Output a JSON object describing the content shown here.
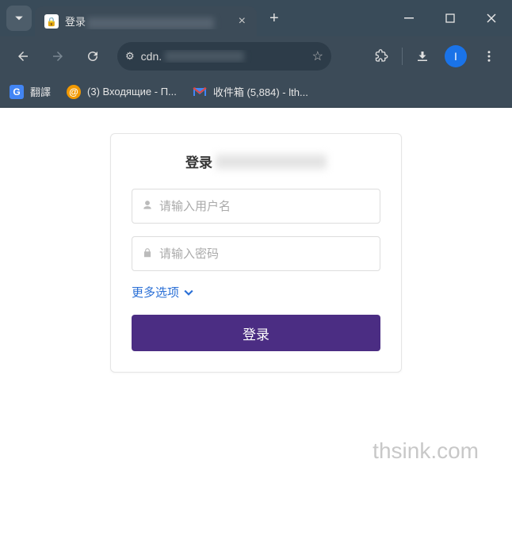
{
  "browser": {
    "tab_title_prefix": "登录",
    "tab_close": "×",
    "new_tab": "+",
    "url_prefix": "cdn.",
    "bookmarks": [
      {
        "label": "翻譯"
      },
      {
        "label": "(3) Входящие - П..."
      },
      {
        "label": "收件箱 (5,884) - lth..."
      }
    ],
    "profile_initial": "I"
  },
  "page": {
    "title_prefix": "登录",
    "username_placeholder": "请输入用户名",
    "password_placeholder": "请输入密码",
    "more_options": "更多选项",
    "login_button": "登录",
    "watermark": "thsink.com"
  }
}
